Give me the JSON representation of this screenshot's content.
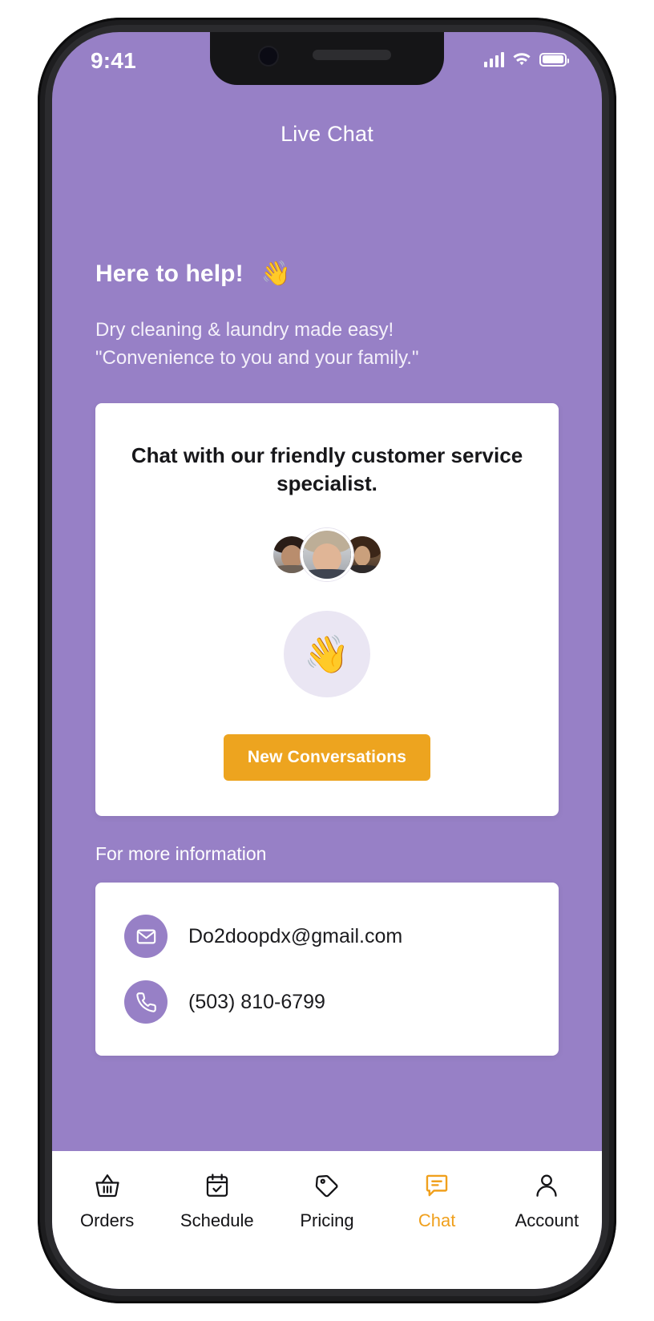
{
  "statusbar": {
    "time": "9:41",
    "signal_icon": "signal-bars-icon",
    "wifi_icon": "wifi-icon",
    "battery_icon": "battery-icon"
  },
  "header": {
    "title": "Live Chat"
  },
  "hero": {
    "heading": "Here to help!",
    "heading_emoji": "👋",
    "line1": "Dry cleaning & laundry made easy!",
    "line2": "\"Convenience to you and your family.\""
  },
  "chat_card": {
    "title": "Chat with our friendly customer service specialist.",
    "avatars": [
      {
        "name": "agent-avatar-1"
      },
      {
        "name": "agent-avatar-2"
      },
      {
        "name": "agent-avatar-3"
      }
    ],
    "wave_emoji": "👋",
    "button_label": "New Conversations"
  },
  "more_info": {
    "label": "For more information",
    "contacts": [
      {
        "icon": "envelope-icon",
        "value": "Do2doopdx@gmail.com"
      },
      {
        "icon": "phone-icon",
        "value": "(503) 810-6799"
      }
    ]
  },
  "tabbar": {
    "items": [
      {
        "icon": "basket-icon",
        "label": "Orders"
      },
      {
        "icon": "calendar-check-icon",
        "label": "Schedule"
      },
      {
        "icon": "tag-icon",
        "label": "Pricing"
      },
      {
        "icon": "chat-bubble-icon",
        "label": "Chat"
      },
      {
        "icon": "person-icon",
        "label": "Account"
      }
    ],
    "active_index": 3
  },
  "colors": {
    "brand_purple": "#9780c6",
    "accent_orange": "#eda41f",
    "active_tab": "#f0a01d",
    "card_white": "#ffffff",
    "emoji_circle": "#eae6f3"
  }
}
